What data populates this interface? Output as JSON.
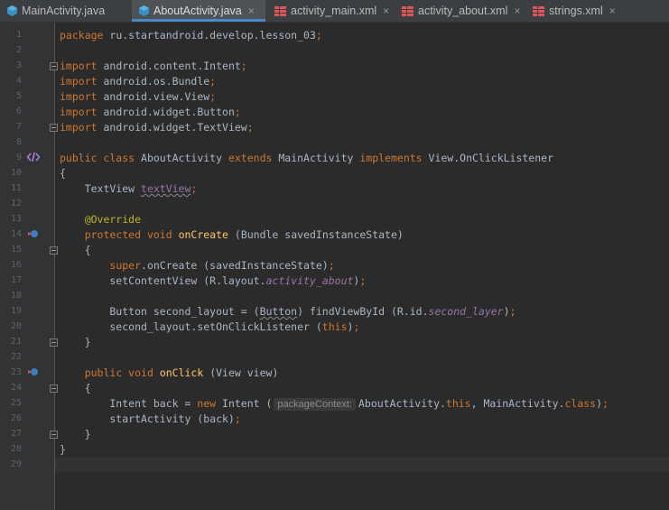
{
  "tabs": [
    {
      "label": "MainActivity.java",
      "type": "java",
      "active": false
    },
    {
      "label": "AboutActivity.java",
      "type": "java",
      "active": true
    },
    {
      "label": "activity_main.xml",
      "type": "xml",
      "active": false
    },
    {
      "label": "activity_about.xml",
      "type": "xml",
      "active": false
    },
    {
      "label": "strings.xml",
      "type": "xml",
      "active": false
    }
  ],
  "tab_close_glyph": "×",
  "line_numbers": [
    "1",
    "2",
    "3",
    "4",
    "5",
    "6",
    "7",
    "8",
    "9",
    "10",
    "11",
    "12",
    "13",
    "14",
    "15",
    "16",
    "17",
    "18",
    "19",
    "20",
    "21",
    "22",
    "23",
    "24",
    "25",
    "26",
    "27",
    "28",
    "29"
  ],
  "code": {
    "l1": [
      "package",
      " ru.startandroid.develop.lesson_03",
      ";"
    ],
    "l3": [
      "import",
      " android.content.Intent",
      ";"
    ],
    "l4": [
      "import",
      " android.os.Bundle",
      ";"
    ],
    "l5": [
      "import",
      " android.view.View",
      ";"
    ],
    "l6": [
      "import",
      " android.widget.Button",
      ";"
    ],
    "l7": [
      "import",
      " android.widget.TextView",
      ";"
    ],
    "l9": [
      "public class",
      " AboutActivity ",
      "extends",
      " MainActivity ",
      "implements",
      " View.OnClickListener"
    ],
    "l10": "{",
    "l11": [
      "    TextView ",
      "textView",
      ";"
    ],
    "l13": "    @Override",
    "l14": [
      "    ",
      "protected void",
      " ",
      "onCreate",
      " (Bundle savedInstanceState)"
    ],
    "l15": "    {",
    "l16": [
      "        ",
      "super",
      ".onCreate (savedInstanceState)",
      ";"
    ],
    "l17": [
      "        setContentView (R.layout.",
      "activity_about",
      ")",
      ";"
    ],
    "l19": [
      "        Button second_layout = (",
      "Button",
      ") findViewById (R.id.",
      "second_layer",
      ")",
      ";"
    ],
    "l20": [
      "        second_layout.setOnClickListener (",
      "this",
      ")",
      ";"
    ],
    "l21": "    }",
    "l23": [
      "    ",
      "public void",
      " ",
      "onClick",
      " (View view)"
    ],
    "l24": "    {",
    "l25": [
      "        Intent back = ",
      "new",
      " Intent (",
      "packageContext:",
      "AboutActivity.",
      "this",
      ", MainActivity.",
      "class",
      ")",
      ";"
    ],
    "l26": [
      "        startActivity (back)",
      ";"
    ],
    "l27": "    }",
    "l28": "}"
  },
  "icons": {
    "java_tab": "java-class-icon",
    "xml_tab": "xml-layout-icon",
    "line9": "implementation-gutter-icon",
    "line14": "override-gutter-icon",
    "line23": "implements-gutter-icon"
  },
  "colors": {
    "keyword": "#cc7832",
    "method_decl": "#ffc66d",
    "field": "#9876aa",
    "annotation": "#bbb529",
    "text": "#a9b7c6",
    "background": "#2b2b2b",
    "tab_accent": "#4a88c7"
  }
}
